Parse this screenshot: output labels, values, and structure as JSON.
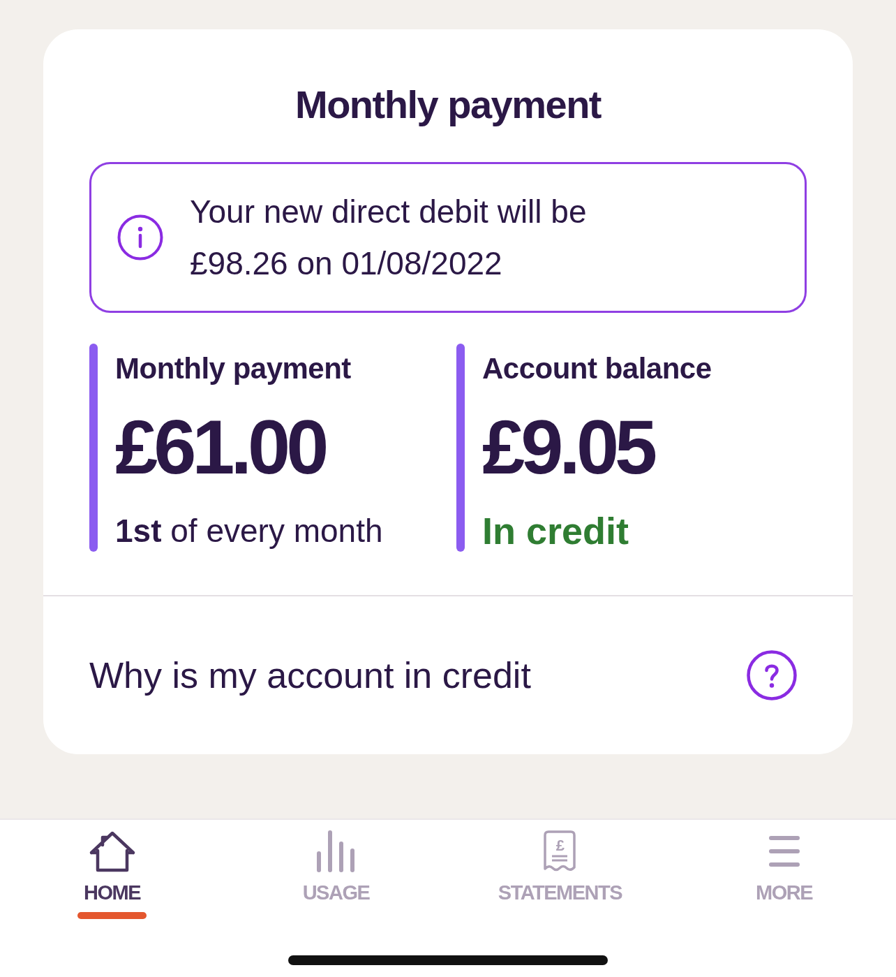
{
  "card": {
    "title": "Monthly payment",
    "notice": {
      "text": "Your new direct debit will be £98.26 on 01/08/2022"
    },
    "stats": [
      {
        "kind": "schedule",
        "label": "Monthly payment",
        "amount": "£61.00",
        "note": "**1st** of every month"
      },
      {
        "kind": "status",
        "label": "Account balance",
        "amount": "£9.05",
        "note": "In credit"
      }
    ],
    "help_link": {
      "text": "Why is my account in credit"
    }
  },
  "nav": {
    "items": [
      {
        "label": "HOME",
        "selected": true
      },
      {
        "label": "USAGE",
        "selected": false
      },
      {
        "label": "STATEMENTS",
        "selected": false,
        "icon_text": "£"
      },
      {
        "label": "MORE",
        "selected": false
      }
    ]
  }
}
